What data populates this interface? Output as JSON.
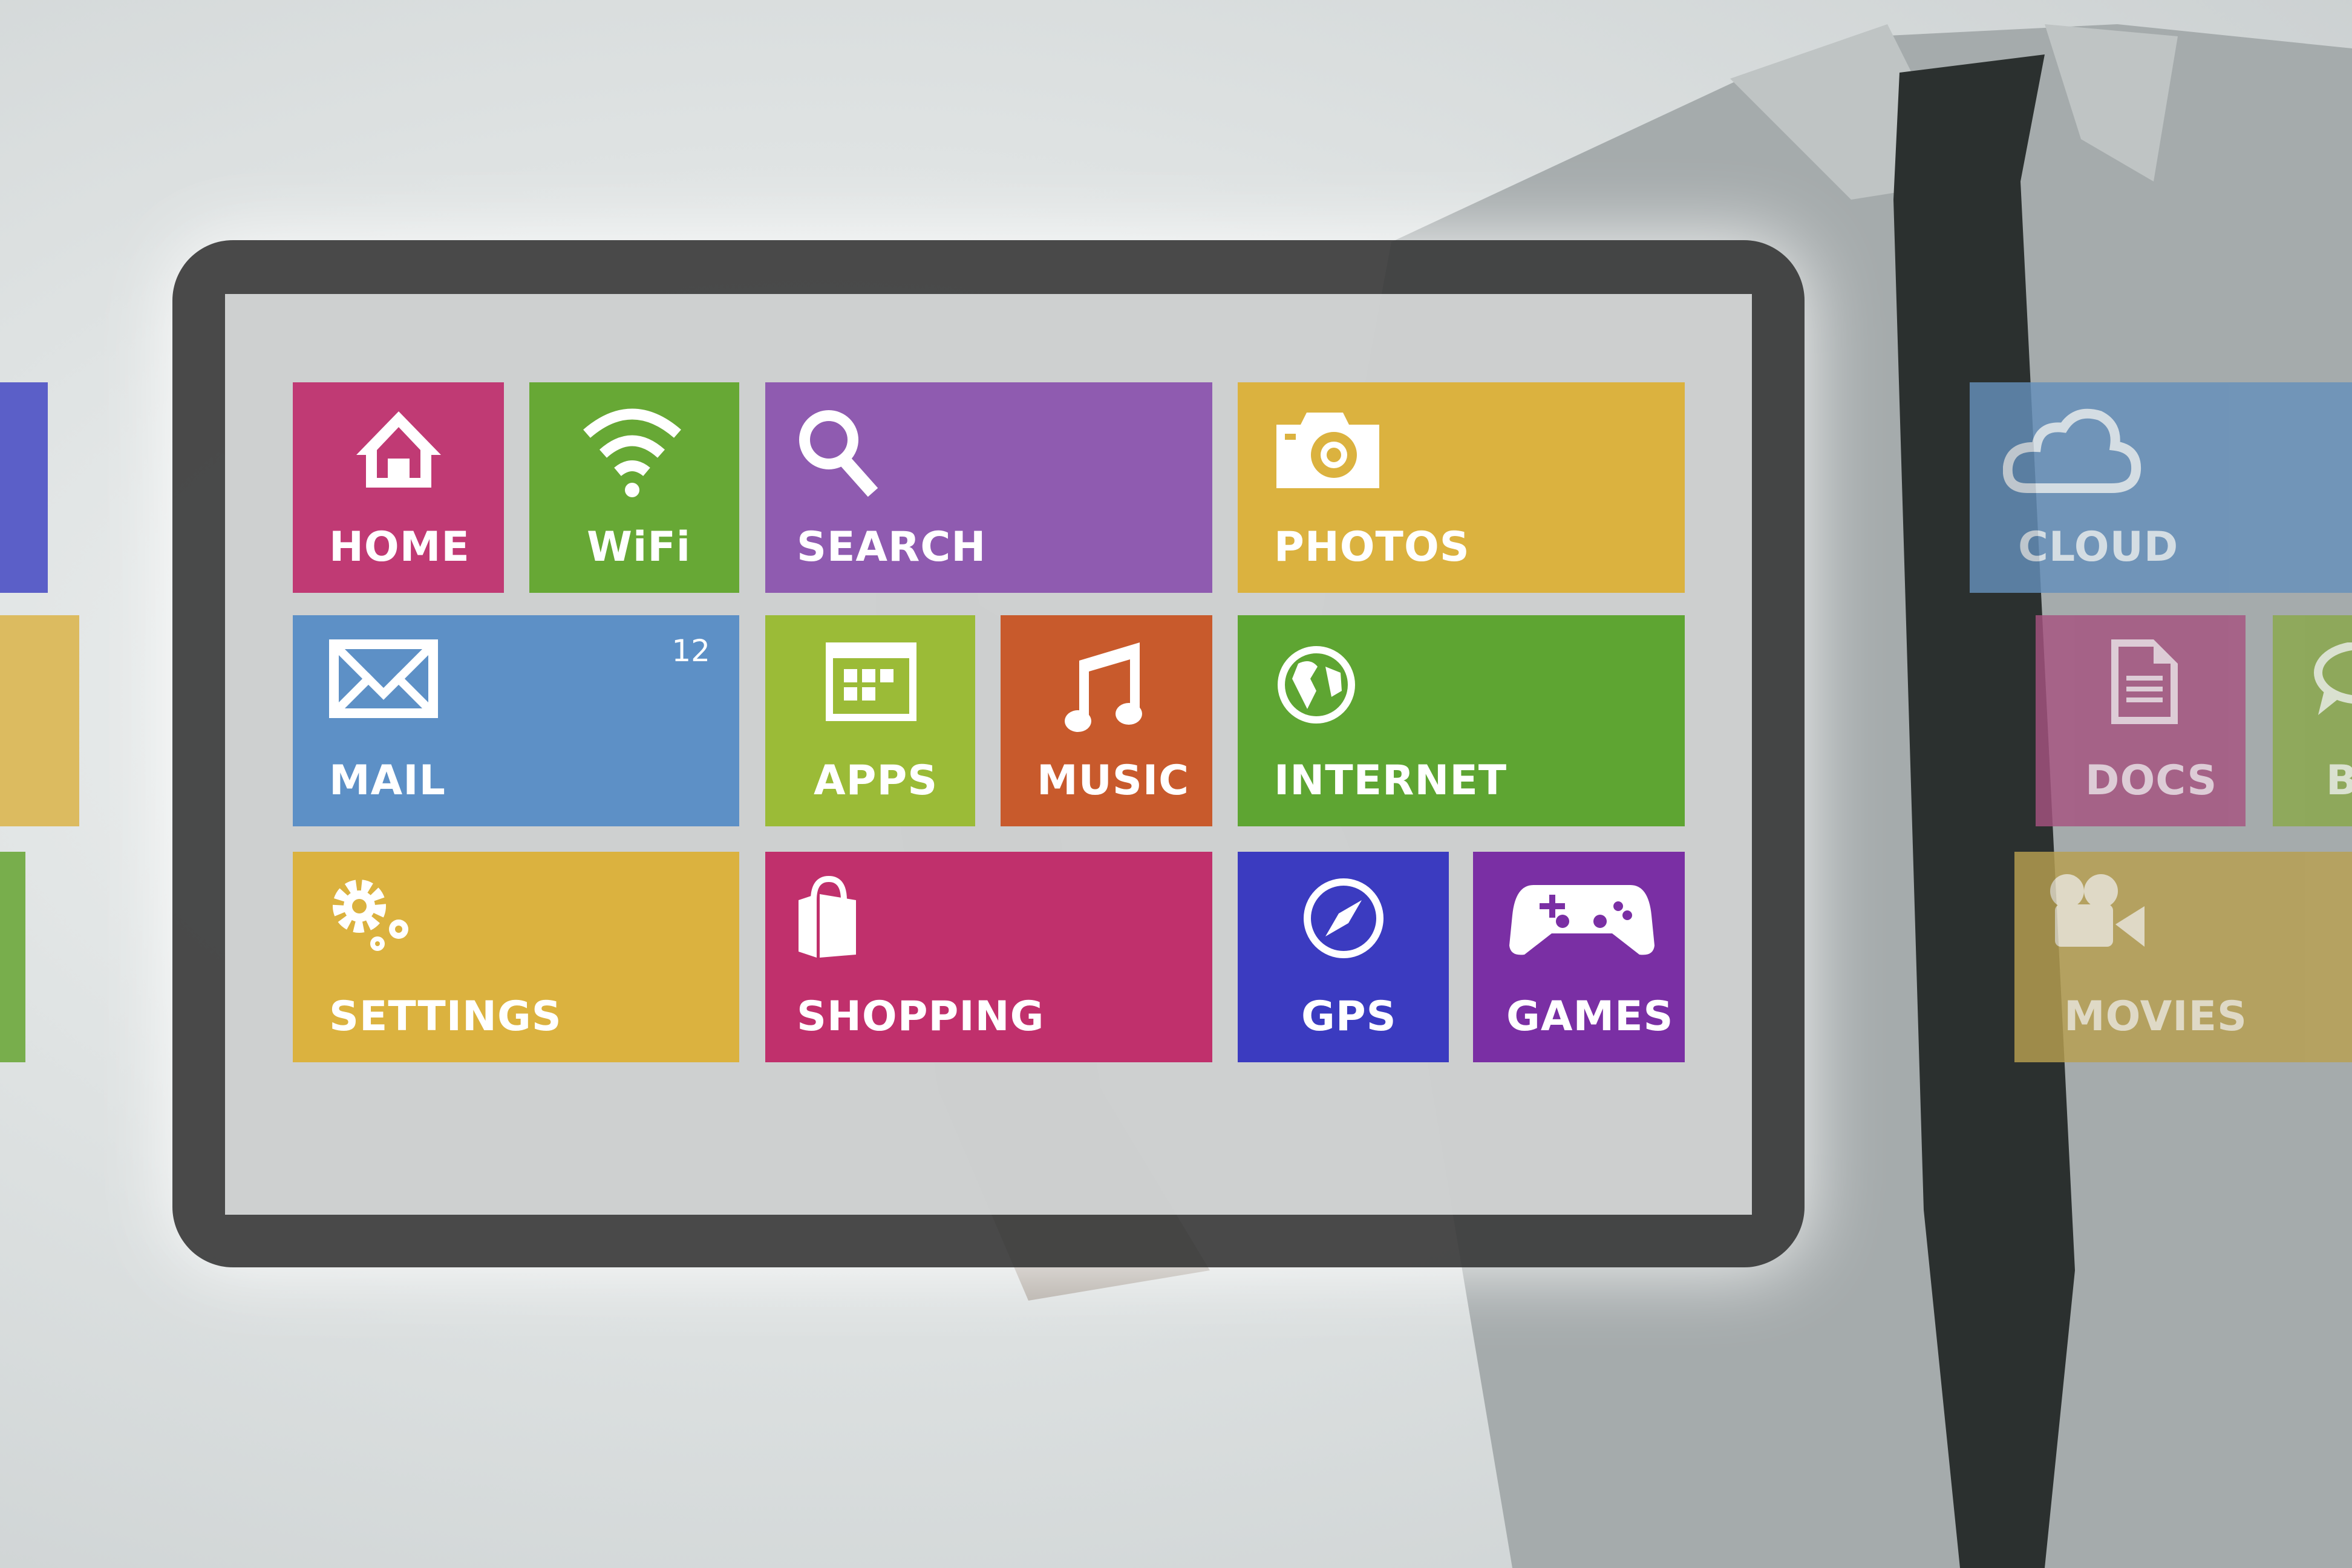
{
  "tiles": {
    "home": {
      "label": "HOME",
      "icon": "house-icon",
      "color": "#c03a74"
    },
    "wifi": {
      "label": "WiFi",
      "icon": "wifi-icon",
      "color": "#67a835"
    },
    "search": {
      "label": "SEARCH",
      "icon": "magnifier-icon",
      "color": "#8f5bb0"
    },
    "photos": {
      "label": "PHOTOS",
      "icon": "camera-icon",
      "color": "#dbb23f"
    },
    "mail": {
      "label": "MAIL",
      "icon": "envelope-icon",
      "color": "#5d90c6",
      "badge": "12"
    },
    "apps": {
      "label": "APPS",
      "icon": "app-grid-icon",
      "color": "#9bbb37"
    },
    "music": {
      "label": "MUSIC",
      "icon": "music-note-icon",
      "color": "#c85a2c"
    },
    "internet": {
      "label": "INTERNET",
      "icon": "globe-icon",
      "color": "#5ea532"
    },
    "settings": {
      "label": "SETTINGS",
      "icon": "gears-icon",
      "color": "#dbb23f"
    },
    "shopping": {
      "label": "SHOPPING",
      "icon": "shopping-bag-icon",
      "color": "#c0306c"
    },
    "gps": {
      "label": "GPS",
      "icon": "compass-icon",
      "color": "#3b3bc0"
    },
    "games": {
      "label": "GAMES",
      "icon": "gamepad-icon",
      "color": "#7a2fa4"
    },
    "cloud": {
      "label": "CLOUD",
      "icon": "cloud-icon",
      "color": "#6590bb"
    },
    "docs": {
      "label": "DOCS",
      "icon": "document-icon",
      "color": "#a65380"
    },
    "b": {
      "label": "B",
      "icon": "speech-bubble-icon",
      "color": "#8aa84a"
    },
    "movies": {
      "label": "MOVIES",
      "icon": "movie-camera-icon",
      "color": "#b8a050"
    }
  }
}
